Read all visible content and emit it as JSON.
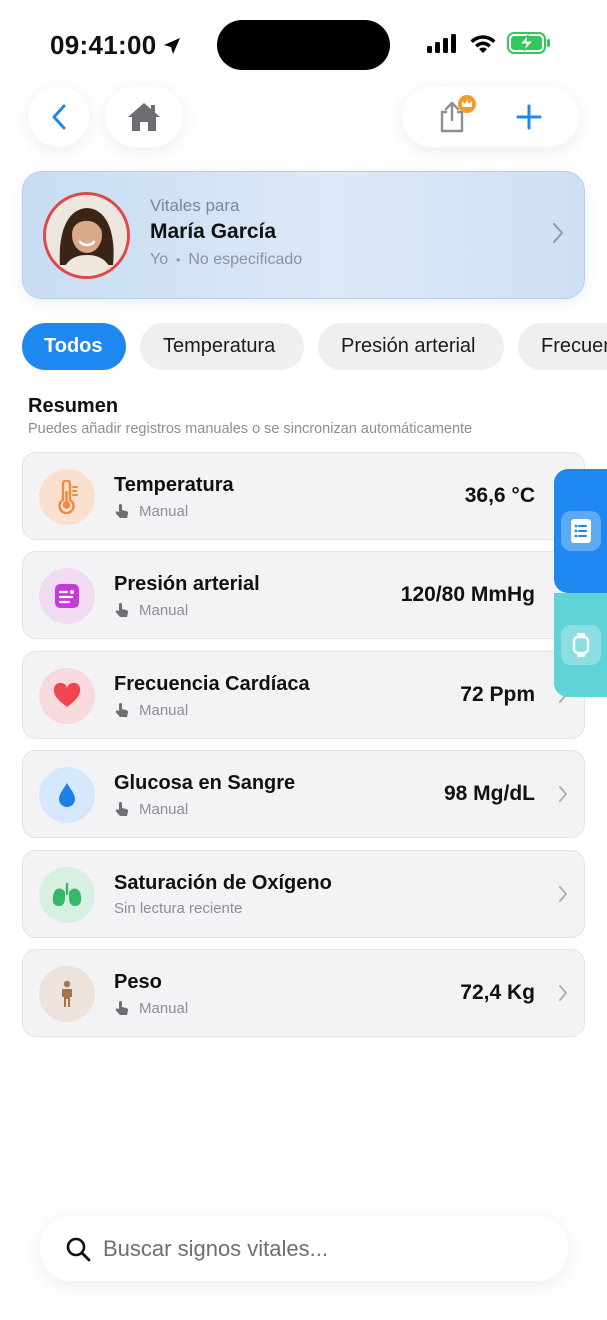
{
  "status_bar": {
    "time": "09:41:00",
    "icons": [
      "location-arrow-icon",
      "cellular-signal-icon",
      "wifi-icon",
      "battery-charging-icon"
    ]
  },
  "nav": {
    "back_icon": "chevron-left-icon",
    "home_icon": "house-icon",
    "share_icon": "share-icon",
    "badge_icon": "crown-icon",
    "add_icon": "plus-icon"
  },
  "colors": {
    "accent": "#1f88f0",
    "card_bg": "#f3f3f6",
    "chip_bg": "#efeff2",
    "avatar_ring": "#e04848",
    "side_top": "#1f88f0",
    "side_bottom": "#5fd3d8"
  },
  "profile": {
    "caption": "Vitales para",
    "name": "María García",
    "relation": "Yo",
    "separator": "•",
    "status": "No especificado"
  },
  "filters": [
    {
      "label": "Todos",
      "active": true
    },
    {
      "label": "Temperatura",
      "active": false
    },
    {
      "label": "Presión arterial",
      "active": false
    },
    {
      "label": "Frecuencia",
      "active": false
    }
  ],
  "summary": {
    "title": "Resumen",
    "subtitle": "Puedes añadir registros manuales o se sincronizan automáticamente"
  },
  "vitals": [
    {
      "name": "Temperatura",
      "source": "Manual",
      "value": "36,6 °C",
      "icon": "thermometer-icon",
      "color": "#f08a3c"
    },
    {
      "name": "Presión arterial",
      "source": "Manual",
      "value": "120/80 MmHg",
      "icon": "blood-pressure-icon",
      "color": "#c43bd6"
    },
    {
      "name": "Frecuencia Cardíaca",
      "source": "Manual",
      "value": "72 Ppm",
      "icon": "heart-icon",
      "color": "#f0454f"
    },
    {
      "name": "Glucosa en Sangre",
      "source": "Manual",
      "value": "98 Mg/dL",
      "icon": "drop-icon",
      "color": "#1f7fe6"
    },
    {
      "name": "Saturación de Oxígeno",
      "source": "Sin lectura reciente",
      "value": "",
      "icon": "lungs-icon",
      "color": "#36b86a"
    },
    {
      "name": "Peso",
      "source": "Manual",
      "value": "72,4 Kg",
      "icon": "person-icon",
      "color": "#a8724a"
    }
  ],
  "side_panel": {
    "top_icon": "list-icon",
    "bottom_icon": "watch-icon"
  },
  "search": {
    "placeholder": "Buscar signos vitales..."
  }
}
